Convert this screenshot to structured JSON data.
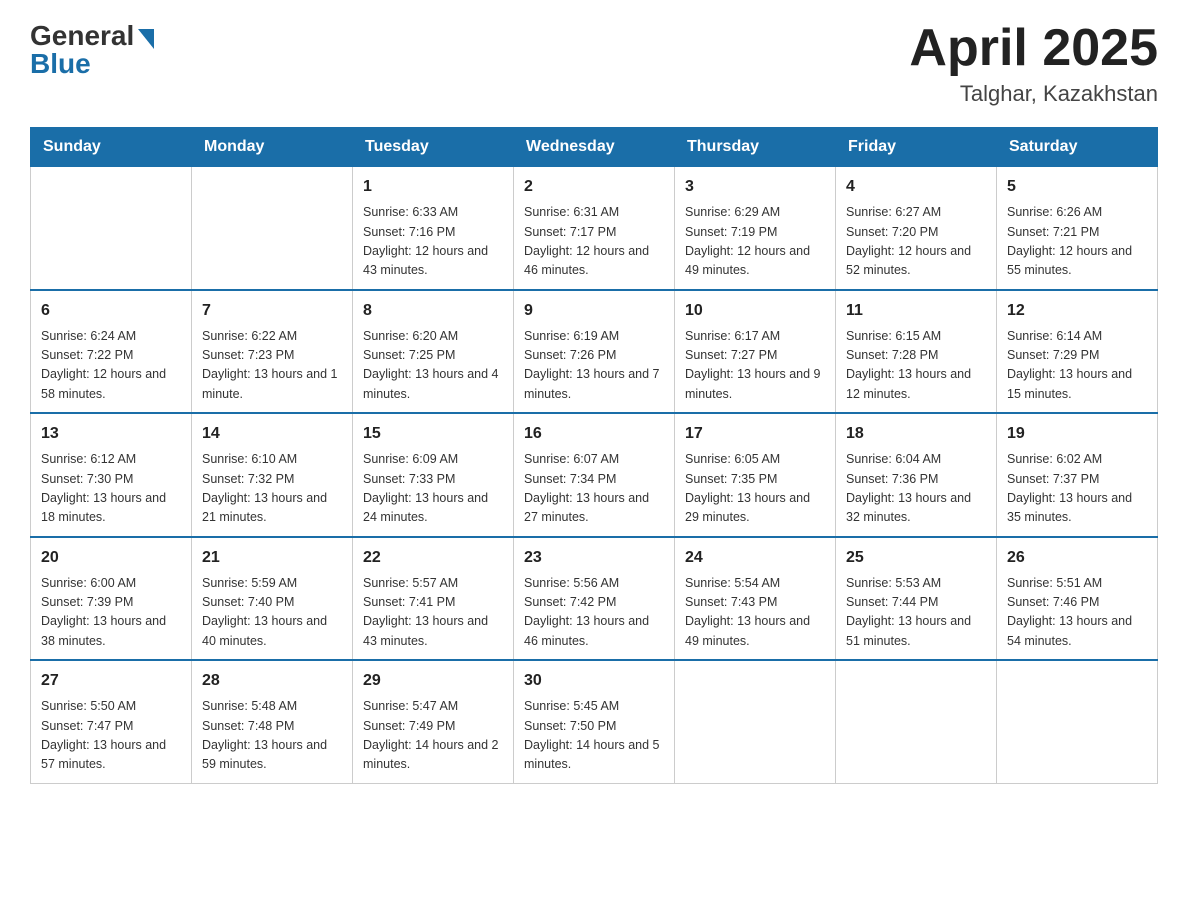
{
  "header": {
    "logo_general": "General",
    "logo_blue": "Blue",
    "month_title": "April 2025",
    "location": "Talghar, Kazakhstan"
  },
  "weekdays": [
    "Sunday",
    "Monday",
    "Tuesday",
    "Wednesday",
    "Thursday",
    "Friday",
    "Saturday"
  ],
  "weeks": [
    [
      {
        "day": "",
        "info": ""
      },
      {
        "day": "",
        "info": ""
      },
      {
        "day": "1",
        "info": "Sunrise: 6:33 AM\nSunset: 7:16 PM\nDaylight: 12 hours\nand 43 minutes."
      },
      {
        "day": "2",
        "info": "Sunrise: 6:31 AM\nSunset: 7:17 PM\nDaylight: 12 hours\nand 46 minutes."
      },
      {
        "day": "3",
        "info": "Sunrise: 6:29 AM\nSunset: 7:19 PM\nDaylight: 12 hours\nand 49 minutes."
      },
      {
        "day": "4",
        "info": "Sunrise: 6:27 AM\nSunset: 7:20 PM\nDaylight: 12 hours\nand 52 minutes."
      },
      {
        "day": "5",
        "info": "Sunrise: 6:26 AM\nSunset: 7:21 PM\nDaylight: 12 hours\nand 55 minutes."
      }
    ],
    [
      {
        "day": "6",
        "info": "Sunrise: 6:24 AM\nSunset: 7:22 PM\nDaylight: 12 hours\nand 58 minutes."
      },
      {
        "day": "7",
        "info": "Sunrise: 6:22 AM\nSunset: 7:23 PM\nDaylight: 13 hours\nand 1 minute."
      },
      {
        "day": "8",
        "info": "Sunrise: 6:20 AM\nSunset: 7:25 PM\nDaylight: 13 hours\nand 4 minutes."
      },
      {
        "day": "9",
        "info": "Sunrise: 6:19 AM\nSunset: 7:26 PM\nDaylight: 13 hours\nand 7 minutes."
      },
      {
        "day": "10",
        "info": "Sunrise: 6:17 AM\nSunset: 7:27 PM\nDaylight: 13 hours\nand 9 minutes."
      },
      {
        "day": "11",
        "info": "Sunrise: 6:15 AM\nSunset: 7:28 PM\nDaylight: 13 hours\nand 12 minutes."
      },
      {
        "day": "12",
        "info": "Sunrise: 6:14 AM\nSunset: 7:29 PM\nDaylight: 13 hours\nand 15 minutes."
      }
    ],
    [
      {
        "day": "13",
        "info": "Sunrise: 6:12 AM\nSunset: 7:30 PM\nDaylight: 13 hours\nand 18 minutes."
      },
      {
        "day": "14",
        "info": "Sunrise: 6:10 AM\nSunset: 7:32 PM\nDaylight: 13 hours\nand 21 minutes."
      },
      {
        "day": "15",
        "info": "Sunrise: 6:09 AM\nSunset: 7:33 PM\nDaylight: 13 hours\nand 24 minutes."
      },
      {
        "day": "16",
        "info": "Sunrise: 6:07 AM\nSunset: 7:34 PM\nDaylight: 13 hours\nand 27 minutes."
      },
      {
        "day": "17",
        "info": "Sunrise: 6:05 AM\nSunset: 7:35 PM\nDaylight: 13 hours\nand 29 minutes."
      },
      {
        "day": "18",
        "info": "Sunrise: 6:04 AM\nSunset: 7:36 PM\nDaylight: 13 hours\nand 32 minutes."
      },
      {
        "day": "19",
        "info": "Sunrise: 6:02 AM\nSunset: 7:37 PM\nDaylight: 13 hours\nand 35 minutes."
      }
    ],
    [
      {
        "day": "20",
        "info": "Sunrise: 6:00 AM\nSunset: 7:39 PM\nDaylight: 13 hours\nand 38 minutes."
      },
      {
        "day": "21",
        "info": "Sunrise: 5:59 AM\nSunset: 7:40 PM\nDaylight: 13 hours\nand 40 minutes."
      },
      {
        "day": "22",
        "info": "Sunrise: 5:57 AM\nSunset: 7:41 PM\nDaylight: 13 hours\nand 43 minutes."
      },
      {
        "day": "23",
        "info": "Sunrise: 5:56 AM\nSunset: 7:42 PM\nDaylight: 13 hours\nand 46 minutes."
      },
      {
        "day": "24",
        "info": "Sunrise: 5:54 AM\nSunset: 7:43 PM\nDaylight: 13 hours\nand 49 minutes."
      },
      {
        "day": "25",
        "info": "Sunrise: 5:53 AM\nSunset: 7:44 PM\nDaylight: 13 hours\nand 51 minutes."
      },
      {
        "day": "26",
        "info": "Sunrise: 5:51 AM\nSunset: 7:46 PM\nDaylight: 13 hours\nand 54 minutes."
      }
    ],
    [
      {
        "day": "27",
        "info": "Sunrise: 5:50 AM\nSunset: 7:47 PM\nDaylight: 13 hours\nand 57 minutes."
      },
      {
        "day": "28",
        "info": "Sunrise: 5:48 AM\nSunset: 7:48 PM\nDaylight: 13 hours\nand 59 minutes."
      },
      {
        "day": "29",
        "info": "Sunrise: 5:47 AM\nSunset: 7:49 PM\nDaylight: 14 hours\nand 2 minutes."
      },
      {
        "day": "30",
        "info": "Sunrise: 5:45 AM\nSunset: 7:50 PM\nDaylight: 14 hours\nand 5 minutes."
      },
      {
        "day": "",
        "info": ""
      },
      {
        "day": "",
        "info": ""
      },
      {
        "day": "",
        "info": ""
      }
    ]
  ]
}
